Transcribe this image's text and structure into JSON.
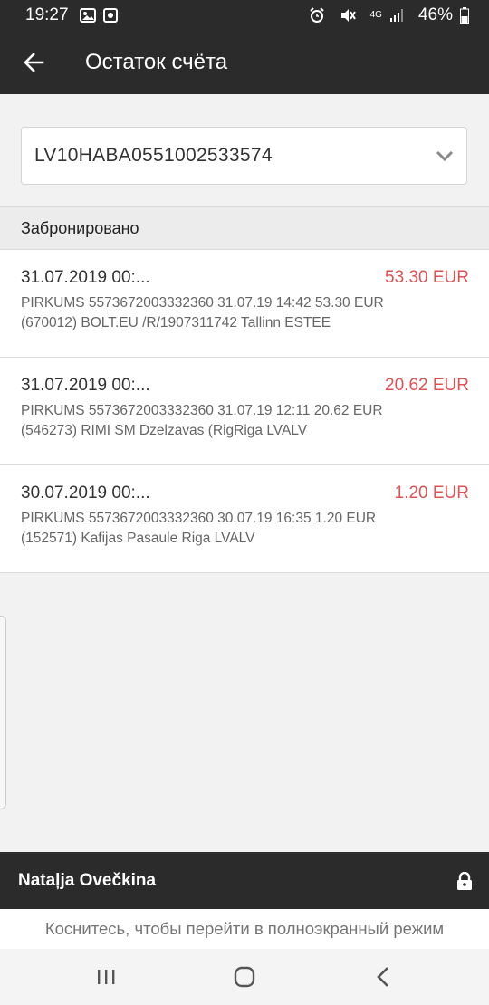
{
  "status_bar": {
    "time": "19:27",
    "network": "4G",
    "battery": "46%",
    "icons": [
      "photo-icon",
      "notification-app-icon",
      "alarm-icon",
      "mute-icon",
      "signal-icon",
      "battery-icon"
    ]
  },
  "header": {
    "title": "Остаток счёта",
    "back_icon": "arrow-left-icon"
  },
  "account": {
    "selected": "LV10HABA0551002533574",
    "dropdown_icon": "chevron-down-icon"
  },
  "section": {
    "title": "Забронировано"
  },
  "transactions": [
    {
      "date": "31.07.2019 00:...",
      "amount": "53.30 EUR",
      "line1": "PIRKUMS 5573672003332360 31.07.19 14:42 53.30 EUR",
      "line2": "(670012) BOLT.EU /R/1907311742 Tallinn ESTEE"
    },
    {
      "date": "31.07.2019 00:...",
      "amount": "20.62 EUR",
      "line1": "PIRKUMS 5573672003332360 31.07.19 12:11 20.62 EUR",
      "line2": "(546273) RIMI SM Dzelzavas (RigRiga LVALV"
    },
    {
      "date": "30.07.2019 00:...",
      "amount": "1.20 EUR",
      "line1": "PIRKUMS 5573672003332360 30.07.19 16:35 1.20 EUR",
      "line2": "(152571) Kafijas Pasaule Riga LVALV"
    }
  ],
  "user": {
    "name": "Nataļja Ovečkina",
    "lock_icon": "lock-icon"
  },
  "fullscreen_hint": "Коснитесь, чтобы перейти в полноэкранный режим",
  "nav": {
    "icons": [
      "recent-apps-icon",
      "home-icon",
      "back-icon"
    ]
  },
  "colors": {
    "bar_dark": "#2b2b2b",
    "amount_red": "#e05252",
    "background": "#f2f2f2"
  }
}
